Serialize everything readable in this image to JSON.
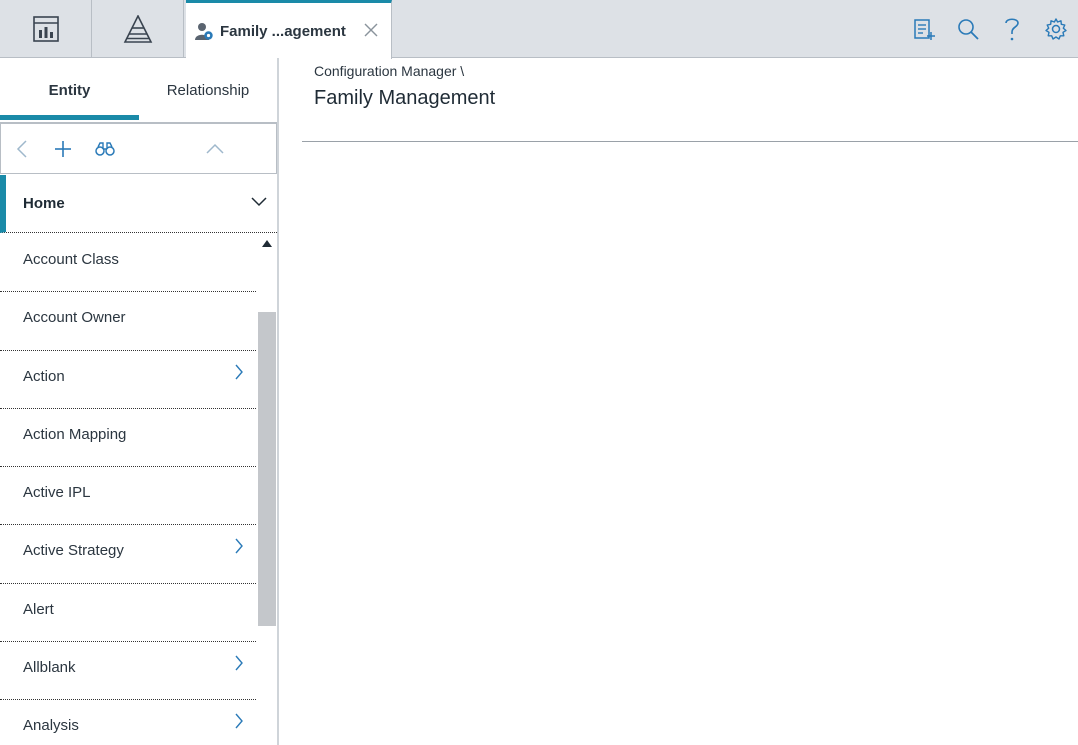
{
  "topbar": {
    "apps": [
      {
        "icon": "dashboard-icon"
      },
      {
        "icon": "pyramid-icon"
      }
    ],
    "active_tab": {
      "label": "Family ...agement",
      "icon": "family-manager-icon"
    },
    "tools": [
      {
        "icon": "clipboard-add-icon"
      },
      {
        "icon": "search-icon"
      },
      {
        "icon": "help-icon"
      },
      {
        "icon": "gear-icon"
      }
    ]
  },
  "left_panel": {
    "tabs": {
      "entity": "Entity",
      "relationship": "Relationship"
    },
    "home_label": "Home",
    "items": [
      {
        "label": "Account Class",
        "has_children": false
      },
      {
        "label": "Account Owner",
        "has_children": false
      },
      {
        "label": "Action",
        "has_children": true
      },
      {
        "label": "Action Mapping",
        "has_children": false
      },
      {
        "label": "Active IPL",
        "has_children": false
      },
      {
        "label": "Active Strategy",
        "has_children": true
      },
      {
        "label": "Alert",
        "has_children": false
      },
      {
        "label": "Allblank",
        "has_children": true
      },
      {
        "label": "Analysis",
        "has_children": true
      }
    ]
  },
  "main": {
    "breadcrumb": "Configuration Manager \\",
    "title": "Family Management"
  },
  "colors": {
    "accent": "#1a8aa8",
    "icon_blue": "#2a7ab8"
  }
}
